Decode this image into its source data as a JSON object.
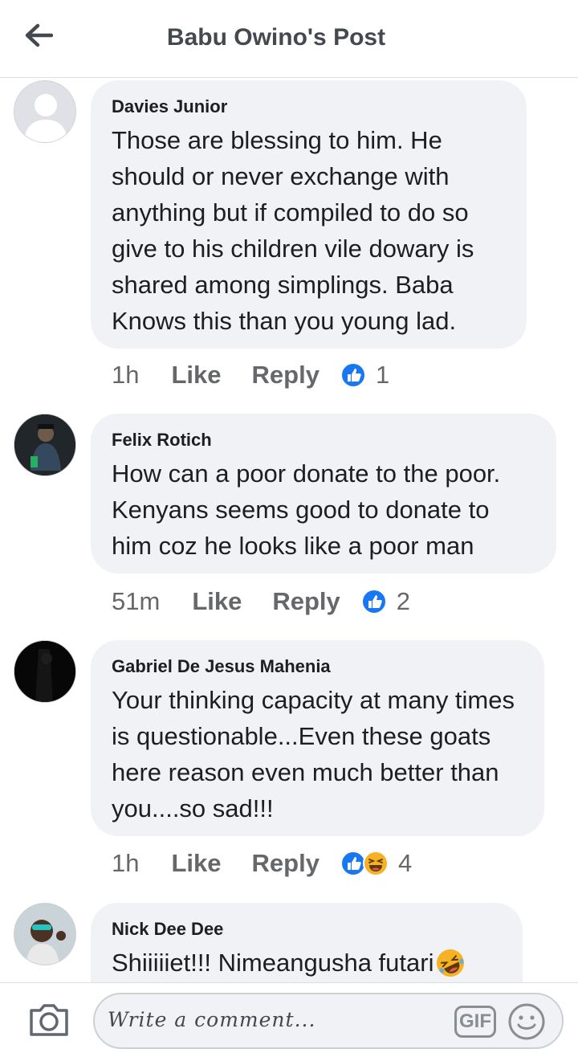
{
  "header": {
    "title": "Babu Owino's Post",
    "back_icon": "arrow-left-icon"
  },
  "comments": [
    {
      "author": "Davies Junior",
      "text": "Those are blessing to him. He should or never exchange with anything but if compiled to do so give to his children vile dowary is shared among simplings.  Baba Knows this than you young lad.",
      "time": "1h",
      "like_label": "Like",
      "reply_label": "Reply",
      "reactions": [
        "like"
      ],
      "reaction_count": "1"
    },
    {
      "author": "Felix Rotich",
      "text": "How can a poor donate to the poor. Kenyans seems good to donate to him coz he looks like a poor man",
      "time": "51m",
      "like_label": "Like",
      "reply_label": "Reply",
      "reactions": [
        "like"
      ],
      "reaction_count": "2"
    },
    {
      "author": "Gabriel De Jesus Mahenia",
      "text": "Your thinking capacity at many times is questionable...Even these goats here reason even much better than you....so sad!!!",
      "time": "1h",
      "like_label": "Like",
      "reply_label": "Reply",
      "reactions": [
        "like",
        "haha"
      ],
      "reaction_count": "4"
    },
    {
      "author": "Nick Dee Dee",
      "text": "Shiiiiiet!!! Nimeangusha futari",
      "emoji": "rolling-laughing-emoji"
    }
  ],
  "composer": {
    "placeholder": "Write a comment...",
    "gif_label": "GIF",
    "camera_icon": "camera-icon",
    "emoji_icon": "smiley-icon"
  },
  "colors": {
    "like_blue": "#1877f2",
    "bubble_bg": "#f0f2f5",
    "meta_gray": "#65676b"
  }
}
